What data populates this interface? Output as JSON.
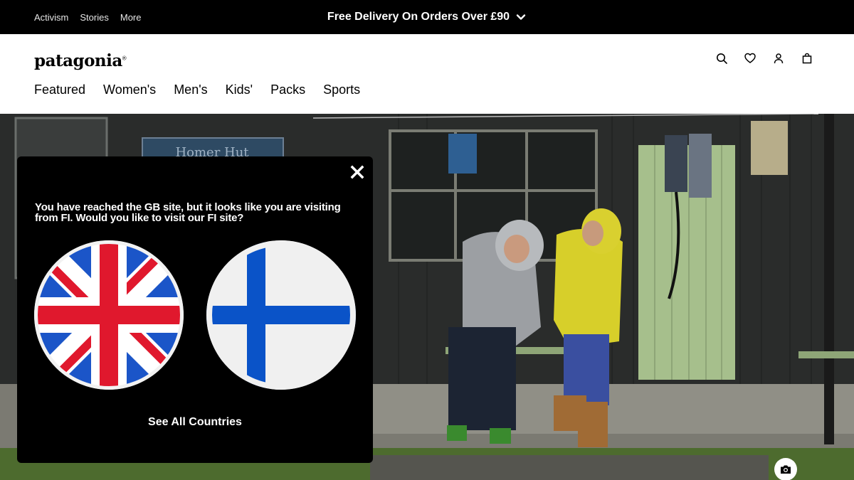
{
  "topbar": {
    "links": [
      "Activism",
      "Stories",
      "More"
    ],
    "promo": "Free Delivery On Orders Over £90",
    "promo_icon": "chevron-down-icon"
  },
  "header": {
    "logo": "patagonia",
    "icons": [
      "search-icon",
      "heart-icon",
      "account-icon",
      "bag-icon"
    ],
    "nav": [
      "Featured",
      "Women's",
      "Men's",
      "Kids'",
      "Packs",
      "Sports"
    ]
  },
  "hero": {
    "sign": "Homer Hut",
    "camera_icon": "camera-icon"
  },
  "modal": {
    "message": "You have reached the GB site, but it looks like you are visiting from FI. Would you like to visit our FI site?",
    "flags": [
      "gb-flag",
      "fi-flag"
    ],
    "see_all": "See All Countries",
    "close_icon": "close-icon"
  },
  "colors": {
    "topbar_bg": "#000000",
    "modal_bg": "#000000",
    "gb_red": "#e0182d",
    "gb_blue": "#1b55c8",
    "fi_blue": "#0a53c8",
    "jacket_yellow": "#d7cf2a",
    "door_green": "#a6bf8c"
  }
}
